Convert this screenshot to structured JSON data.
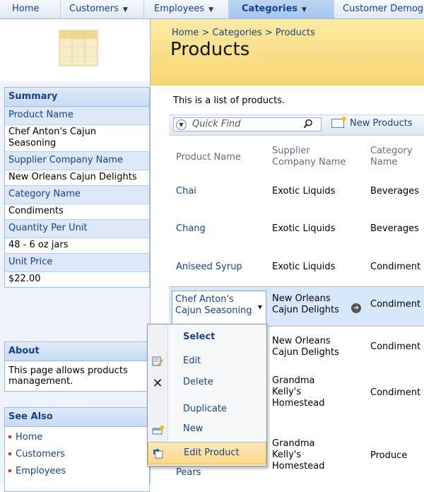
{
  "menu": {
    "items": [
      {
        "label": "Home"
      },
      {
        "label": "Customers",
        "caret": "▼"
      },
      {
        "label": "Employees",
        "caret": "▼"
      },
      {
        "label": "Categories",
        "caret": "▼",
        "active": true
      },
      {
        "label": "Customer Demog"
      }
    ]
  },
  "sidebar": {
    "summary": {
      "title": "Summary",
      "fields": [
        {
          "label": "Product Name",
          "value": "Chef Anton's Cajun Seasoning"
        },
        {
          "label": "Supplier Company Name",
          "value": "New Orleans Cajun Delights"
        },
        {
          "label": "Category Name",
          "value": "Condiments"
        },
        {
          "label": "Quantity Per Unit",
          "value": "48 - 6 oz jars"
        },
        {
          "label": "Unit Price",
          "value": "$22.00"
        }
      ]
    },
    "about": {
      "title": "About",
      "text": "This page allows products management."
    },
    "see_also": {
      "title": "See Also",
      "items": [
        "Home",
        "Customers",
        "Employees"
      ]
    }
  },
  "header": {
    "breadcrumb": "Home > Categories > Products",
    "title": "Products"
  },
  "description": "This is a list of products.",
  "toolbar": {
    "quick_find_placeholder": "Quick Find",
    "new_label": "New Products"
  },
  "table": {
    "headers": [
      "Product Name",
      "Supplier Company Name",
      "Category Name"
    ],
    "rows": [
      {
        "product": "Chai",
        "supplier": "Exotic Liquids",
        "category": "Beverages"
      },
      {
        "product": "Chang",
        "supplier": "Exotic Liquids",
        "category": "Beverages"
      },
      {
        "product": "Aniseed Syrup",
        "supplier": "Exotic Liquids",
        "category": "Condiment"
      },
      {
        "product": "Chef Anton's Cajun Seasoning",
        "supplier": "New Orleans Cajun Delights",
        "category": "Condiment",
        "selected": true
      },
      {
        "product": "",
        "supplier": "New Orleans Cajun Delights",
        "category": "Condiment"
      },
      {
        "product": "",
        "supplier": "Grandma Kelly's Homestead",
        "category": "Condiment"
      },
      {
        "product": "Pears",
        "supplier": "Grandma Kelly's Homestead",
        "category": "Produce"
      }
    ]
  },
  "context_menu": {
    "items": [
      {
        "label": "Select",
        "icon": "",
        "bold": true
      },
      {
        "label": "Edit",
        "icon": "edit-icon"
      },
      {
        "label": "Delete",
        "icon": "delete-icon"
      },
      {
        "label": "Duplicate",
        "icon": ""
      },
      {
        "label": "New",
        "icon": "new-icon"
      },
      {
        "label": "Edit Product",
        "icon": "navigate-icon",
        "highlighted": true
      }
    ]
  }
}
